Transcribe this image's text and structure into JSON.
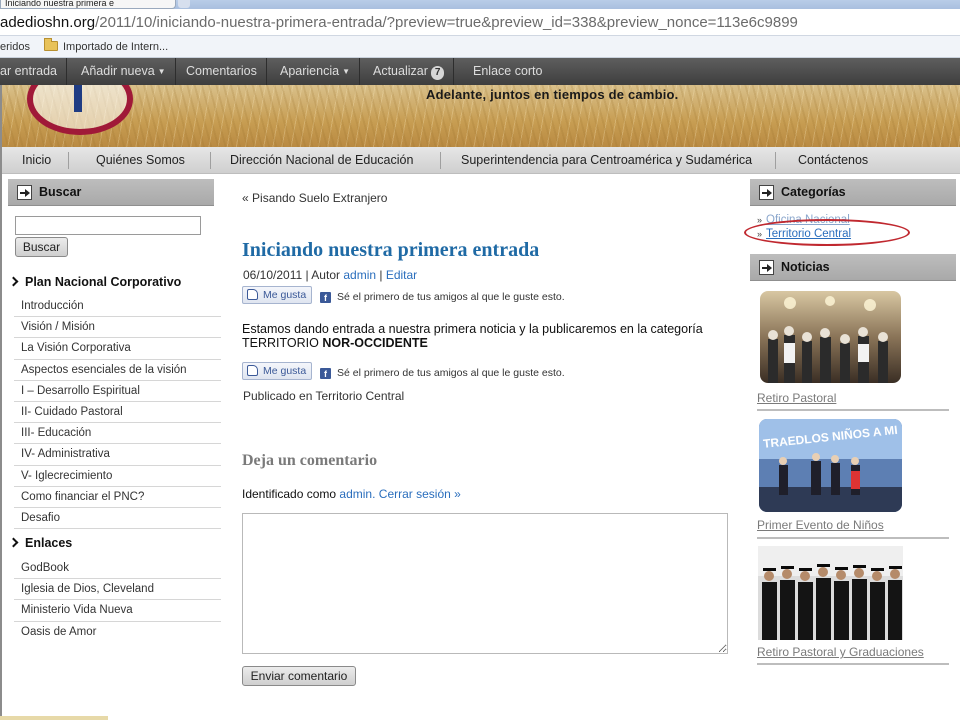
{
  "browser": {
    "tab_title": "Iniciando nuestra primera e",
    "url_host": "adedioshn.org",
    "url_path": "/2011/10/iniciando-nuestra-primera-entrada/?preview=true&preview_id=338&preview_nonce=113e6c9899",
    "bookmarks": [
      "eridos",
      "Importado de Intern..."
    ]
  },
  "adminbar": {
    "items": [
      "ar entrada",
      "Añadir nueva",
      "Comentarios",
      "Apariencia",
      "Actualizar",
      "Enlace corto"
    ],
    "updates_count": "7"
  },
  "header": {
    "tagline": "Adelante, juntos en tiempos de cambio."
  },
  "mainnav": {
    "items": [
      "Inicio",
      "Quiénes Somos",
      "Dirección Nacional de Educación",
      "Superintendencia para Centroamérica y Sudamérica",
      "Contáctenos"
    ]
  },
  "sidebar_left": {
    "search_title": "Buscar",
    "search_button": "Buscar",
    "plan_title": "Plan Nacional Corporativo",
    "plan_items": [
      "Introducción",
      "Visión / Misión",
      "La Visión Corporativa",
      "Aspectos esenciales de la visión",
      "I – Desarrollo Espiritual",
      "II- Cuidado Pastoral",
      "III- Educación",
      "IV- Administrativa",
      "V- Iglecrecimiento",
      "Como financiar el PNC?",
      "Desafio"
    ],
    "links_title": "Enlaces",
    "links_items": [
      "GodBook",
      "Iglesia de Dios, Cleveland",
      "Ministerio Vida Nueva",
      "Oasis de Amor"
    ]
  },
  "post": {
    "prev_link": "Pisando Suelo Extranjero",
    "prev_marker": "«",
    "title": "Iniciando nuestra primera entrada",
    "date": "06/10/2011",
    "meta_author_prefix": "| Autor",
    "author": "admin",
    "edit": "Editar",
    "like_button": "Me gusta",
    "like_text": "Sé el primero de tus amigos al que le guste esto.",
    "body_line1": "Estamos dando entrada a nuestra primera noticia y la publicaremos en la categoría",
    "body_line2_prefix": "TERRITORIO",
    "body_line2_bold": "NOR-OCCIDENTE",
    "published_in": "Publicado en Territorio Central"
  },
  "comments": {
    "title": "Deja un comentario",
    "logged_as": "Identificado como",
    "user": "admin.",
    "logout": "Cerrar sesión »",
    "submit": "Enviar comentario"
  },
  "sidebar_right": {
    "categories_title": "Categorías",
    "categories": [
      "Oficina Nacional",
      "Territorio Central"
    ],
    "news_title": "Noticias",
    "news": [
      "Retiro Pastoral",
      "Primer Evento de Niños",
      "Retiro Pastoral y Graduaciones"
    ],
    "banner_text": "TRAEDLOS NIÑOS A MI"
  },
  "colors": {
    "accent": "#1f6aa5",
    "highlight": "#c0282f"
  }
}
